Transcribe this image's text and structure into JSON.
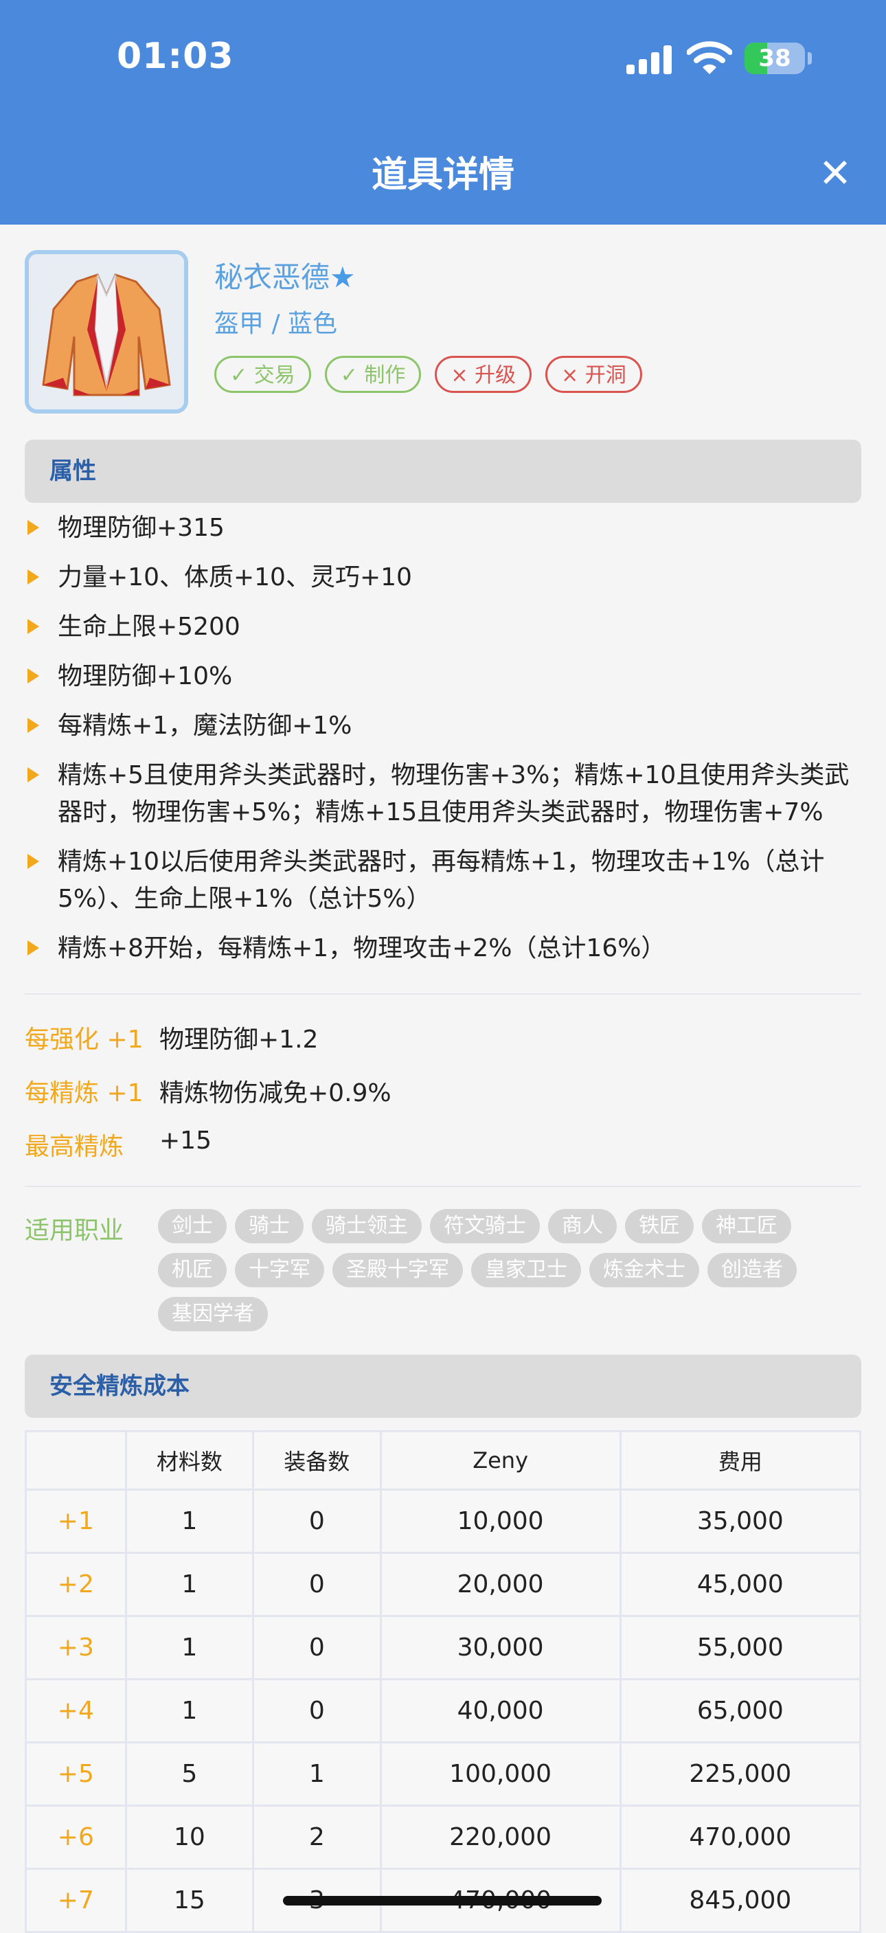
{
  "status_bar": {
    "time": "01:03",
    "battery": "38",
    "battery_level": 0.38
  },
  "header": {
    "title": "道具详情",
    "close_label": "✕"
  },
  "item": {
    "name": "秘衣恶德",
    "star": "★",
    "type": "盔甲 / 蓝色",
    "tags": [
      {
        "label": "交易",
        "ok": true
      },
      {
        "label": "制作",
        "ok": true
      },
      {
        "label": "升级",
        "ok": false
      },
      {
        "label": "开洞",
        "ok": false
      }
    ]
  },
  "attributes": {
    "title": "属性",
    "items": [
      "物理防御+315",
      "力量+10、体质+10、灵巧+10",
      "生命上限+5200",
      "物理防御+10%",
      "每精炼+1，魔法防御+1%",
      "精炼+5且使用斧头类武器时，物理伤害+3%；精炼+10且使用斧头类武器时，物理伤害+5%；精炼+15且使用斧头类武器时，物理伤害+7%",
      "精炼+10以后使用斧头类武器时，再每精炼+1，物理攻击+1%（总计5%）、生命上限+1%（总计5%）",
      "精炼+8开始，每精炼+1，物理攻击+2%（总计16%）"
    ]
  },
  "refine_info": [
    {
      "label": "每强化 +1",
      "value": "物理防御+1.2"
    },
    {
      "label": "每精炼 +1",
      "value": "精炼物伤减免+0.9%"
    },
    {
      "label": "最高精炼",
      "value": "+15"
    }
  ],
  "jobs": {
    "label": "适用职业",
    "items": [
      "剑士",
      "骑士",
      "骑士领主",
      "符文骑士",
      "商人",
      "铁匠",
      "神工匠",
      "机匠",
      "十字军",
      "圣殿十字军",
      "皇家卫士",
      "炼金术士",
      "创造者",
      "基因学者"
    ]
  },
  "cost": {
    "title": "安全精炼成本",
    "headers": [
      "",
      "材料数",
      "装备数",
      "Zeny",
      "费用"
    ],
    "rows": [
      [
        "+1",
        "1",
        "0",
        "10,000",
        "35,000"
      ],
      [
        "+2",
        "1",
        "0",
        "20,000",
        "45,000"
      ],
      [
        "+3",
        "1",
        "0",
        "30,000",
        "55,000"
      ],
      [
        "+4",
        "1",
        "0",
        "40,000",
        "65,000"
      ],
      [
        "+5",
        "5",
        "1",
        "100,000",
        "225,000"
      ],
      [
        "+6",
        "10",
        "2",
        "220,000",
        "470,000"
      ],
      [
        "+7",
        "15",
        "3",
        "470,000",
        "845,000"
      ]
    ]
  },
  "icons": {
    "close": "close-icon",
    "signal": "signal-icon",
    "wifi": "wifi-icon",
    "battery": "battery-icon",
    "check": "check-icon",
    "cross": "cross-icon",
    "bullet": "triangle-bullet-icon"
  },
  "colors": {
    "header_bg": "#4a89dc",
    "accent_orange": "#f2a81d",
    "ok_green": "#8cc46a",
    "no_red": "#d9534f",
    "link_blue": "#5aa1e0",
    "section_title": "#2b5fa8"
  }
}
